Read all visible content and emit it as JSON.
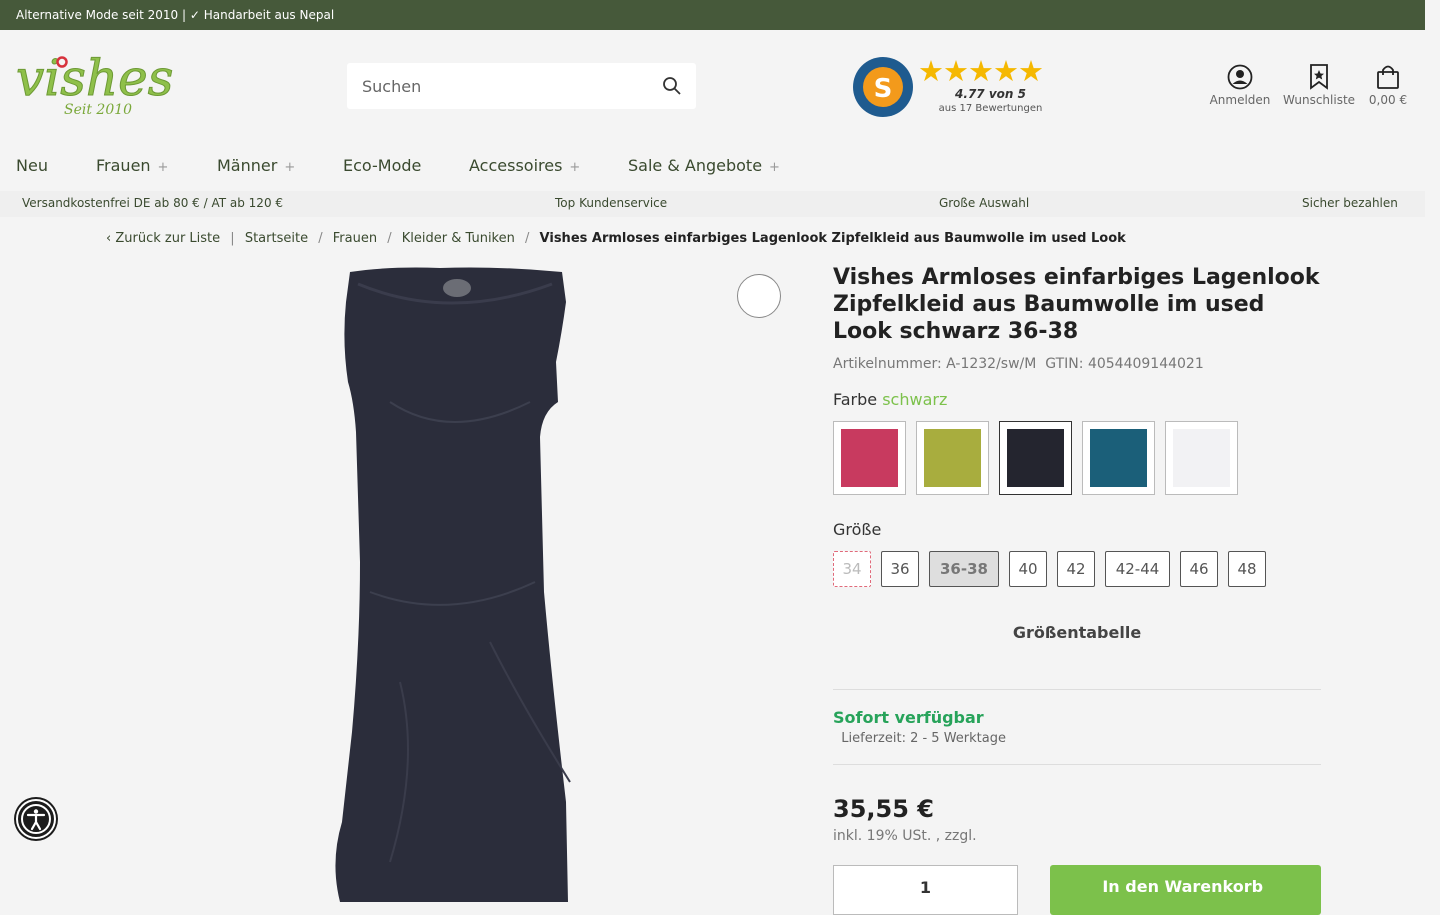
{
  "topbar": {
    "text": "Alternative Mode seit 2010 | ✓ Handarbeit aus Nepal"
  },
  "header": {
    "logo_text": "vishes",
    "logo_sub": "Seit 2010",
    "search_placeholder": "Suchen",
    "shopvote": {
      "badge_text": "S",
      "rating": "4.77 von 5",
      "count": "aus 17 Bewertungen",
      "stars_value": 5
    },
    "actions": [
      {
        "label": "Anmelden",
        "icon": "user-icon"
      },
      {
        "label": "Wunschliste",
        "icon": "bookmark-icon"
      },
      {
        "label": "0,00 €",
        "icon": "shopping-bag-icon"
      }
    ]
  },
  "nav": [
    {
      "label": "Neu",
      "has_sub": false
    },
    {
      "label": "Frauen",
      "has_sub": true
    },
    {
      "label": "Männer",
      "has_sub": true
    },
    {
      "label": "Eco-Mode",
      "has_sub": false
    },
    {
      "label": "Accessoires",
      "has_sub": true
    },
    {
      "label": " Sale & Angebote",
      "has_sub": true
    }
  ],
  "nav_plus": "+",
  "usps": [
    {
      "icon": "",
      "text": "Versandkostenfrei DE ab 80 € / AT ab 120 €"
    },
    {
      "icon": "",
      "text": "Top Kundenservice"
    },
    {
      "icon": "",
      "text": "Große Auswahl"
    },
    {
      "icon": "",
      "text": "Sicher bezahlen"
    }
  ],
  "breadcrumb": {
    "back": "Zurück zur Liste",
    "divider": "|",
    "items": [
      "Startseite",
      "Frauen",
      "Kleider & Tuniken"
    ],
    "sep": "/",
    "current": "Vishes Armloses einfarbiges Lagenlook Zipfelkleid aus Baumwolle im used Look"
  },
  "product": {
    "title": "Vishes Armloses einfarbiges Lagenlook Zipfelkleid aus Baumwolle im used Look schwarz 36-38",
    "article_label": "Artikelnummer:",
    "article_no": "A-1232/sw/M",
    "gtin_label": "GTIN:",
    "gtin": "4054409144021",
    "zoom_icon": "",
    "color_label": "Farbe",
    "color_value": "schwarz",
    "swatches": [
      {
        "name": "pink",
        "color": "#c83a5f",
        "selected": false
      },
      {
        "name": "lime",
        "color": "#a8ad3e",
        "selected": false
      },
      {
        "name": "black",
        "color": "#24252f",
        "selected": true
      },
      {
        "name": "petrol",
        "color": "#1b5f79",
        "selected": false
      },
      {
        "name": "white",
        "color": "#f2f2f4",
        "selected": false
      }
    ],
    "size_label": "Größe",
    "sizes": [
      {
        "label": "34",
        "state": "na"
      },
      {
        "label": "36",
        "state": "normal"
      },
      {
        "label": "36-38",
        "state": "selected"
      },
      {
        "label": "40",
        "state": "normal"
      },
      {
        "label": "42",
        "state": "normal"
      },
      {
        "label": "42-44",
        "state": "normal"
      },
      {
        "label": "46",
        "state": "normal"
      },
      {
        "label": "48",
        "state": "normal"
      }
    ],
    "size_chart": "Größentabelle",
    "availability": "Sofort verfügbar",
    "delivery_icon": "",
    "delivery": "Lieferzeit: 2 - 5 Werktage",
    "price": "35,55 €",
    "tax": "inkl. 19% USt. , zzgl.",
    "qty": "1",
    "qty_minus_icon": "",
    "qty_plus_icon": "",
    "add_to_cart": "In den Warenkorb",
    "add_to_cart_icon": ""
  },
  "colors": {
    "topbar": "#46593a",
    "accent_green": "#7cc14b",
    "available_green": "#27a35a",
    "dress": "#2b2d3b"
  }
}
